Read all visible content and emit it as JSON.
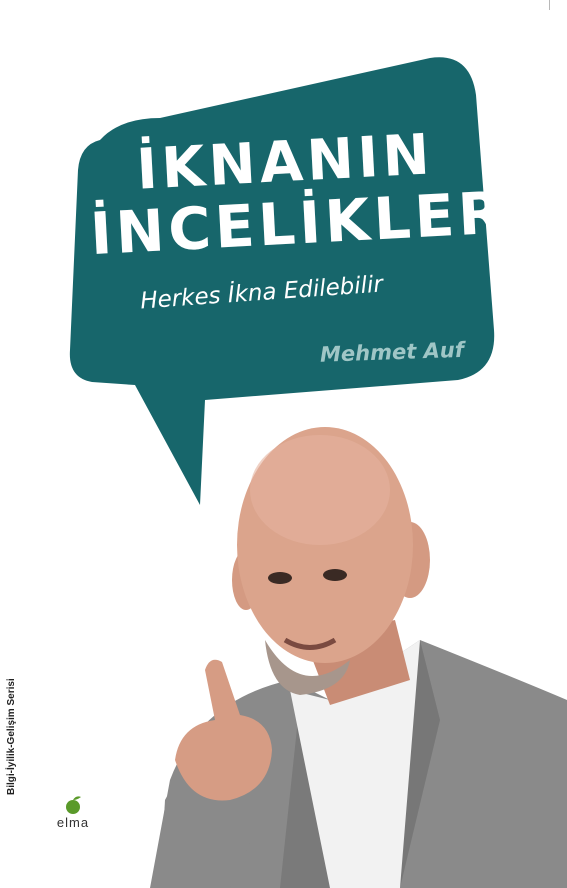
{
  "cover": {
    "title_line1": "İKNANIN",
    "title_line2": "İNCELİKLERİ",
    "subtitle": "Herkes İkna Edilebilir",
    "author": "Mehmet Auf",
    "series": "Bilgi-İyilik-Gelişim Serisi",
    "publisher": "elma"
  },
  "colors": {
    "bubble": "#17666b",
    "title_text": "#ffffff",
    "author_text": "#9fc6c6",
    "background": "#ffffff",
    "jacket": "#8a8a8a",
    "shirt": "#f2f2f2",
    "skin": "#d9a088",
    "logo_leaf": "#5a9a2a"
  },
  "icons": {
    "publisher_logo": "apple-icon"
  }
}
